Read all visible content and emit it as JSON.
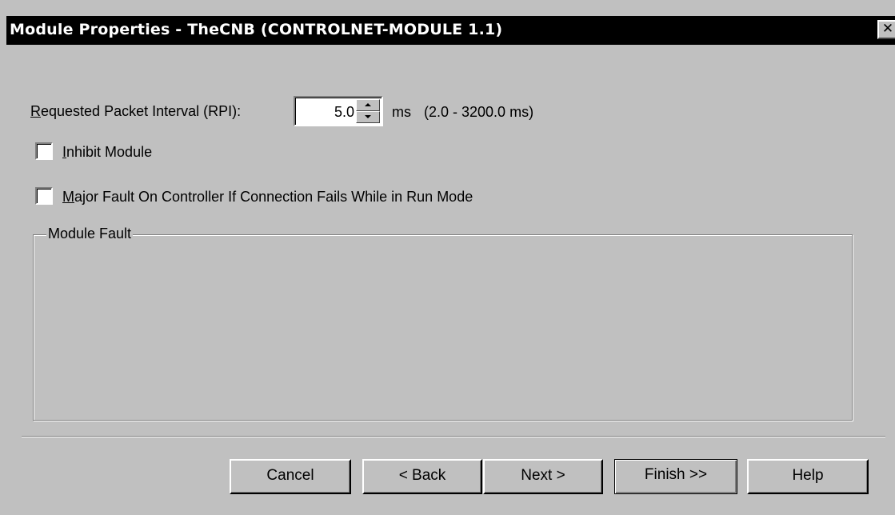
{
  "window": {
    "title": "Module Properties - TheCNB (CONTROLNET-MODULE 1.1)",
    "close_glyph": "✕"
  },
  "rpi": {
    "label_key": "R",
    "label_rest": "equested Packet Interval (RPI):",
    "value": "5.0",
    "unit": "ms",
    "range": "(2.0 - 3200.0 ms)"
  },
  "inhibit": {
    "label_key": "I",
    "label_rest": "nhibit Module",
    "checked": false
  },
  "major_fault": {
    "label_key": "M",
    "label_rest": "ajor Fault On Controller If Connection Fails While in Run Mode",
    "checked": false
  },
  "module_fault": {
    "legend": "Module Fault"
  },
  "buttons": {
    "cancel": "Cancel",
    "back": "< Back",
    "next": "Next >",
    "finish": "Finish >>",
    "help": "Help"
  },
  "icons": {
    "close": "close-icon",
    "spin_up": "spin-up-arrow-icon",
    "spin_down": "spin-down-arrow-icon"
  },
  "colors": {
    "dialog_bg": "#c0c0c0",
    "titlebar_bg": "#000000",
    "titlebar_text": "#ffffff"
  }
}
